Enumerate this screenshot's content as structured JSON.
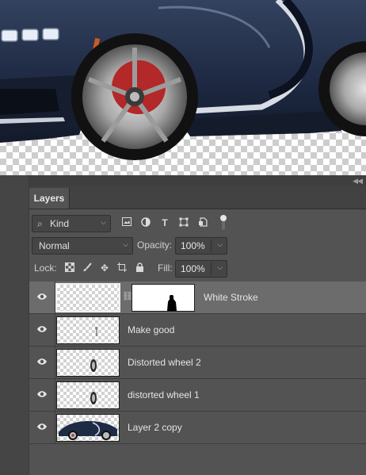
{
  "panel": {
    "tab_label": "Layers"
  },
  "filter": {
    "kind_label": "Kind"
  },
  "blend": {
    "mode": "Normal",
    "opacity_label": "Opacity:",
    "opacity_value": "100%"
  },
  "lock": {
    "label": "Lock:",
    "fill_label": "Fill:",
    "fill_value": "100%"
  },
  "layers": [
    {
      "name": "White Stroke",
      "selected": true,
      "has_mask": true
    },
    {
      "name": "Make good"
    },
    {
      "name": "Distorted wheel 2"
    },
    {
      "name": "distorted wheel 1"
    },
    {
      "name": "Layer 2 copy"
    }
  ],
  "colors": {
    "panel_bg": "#535353",
    "selected_row": "#6c6c6c",
    "tab_bar": "#424242",
    "car_body": "#1e2b45"
  }
}
